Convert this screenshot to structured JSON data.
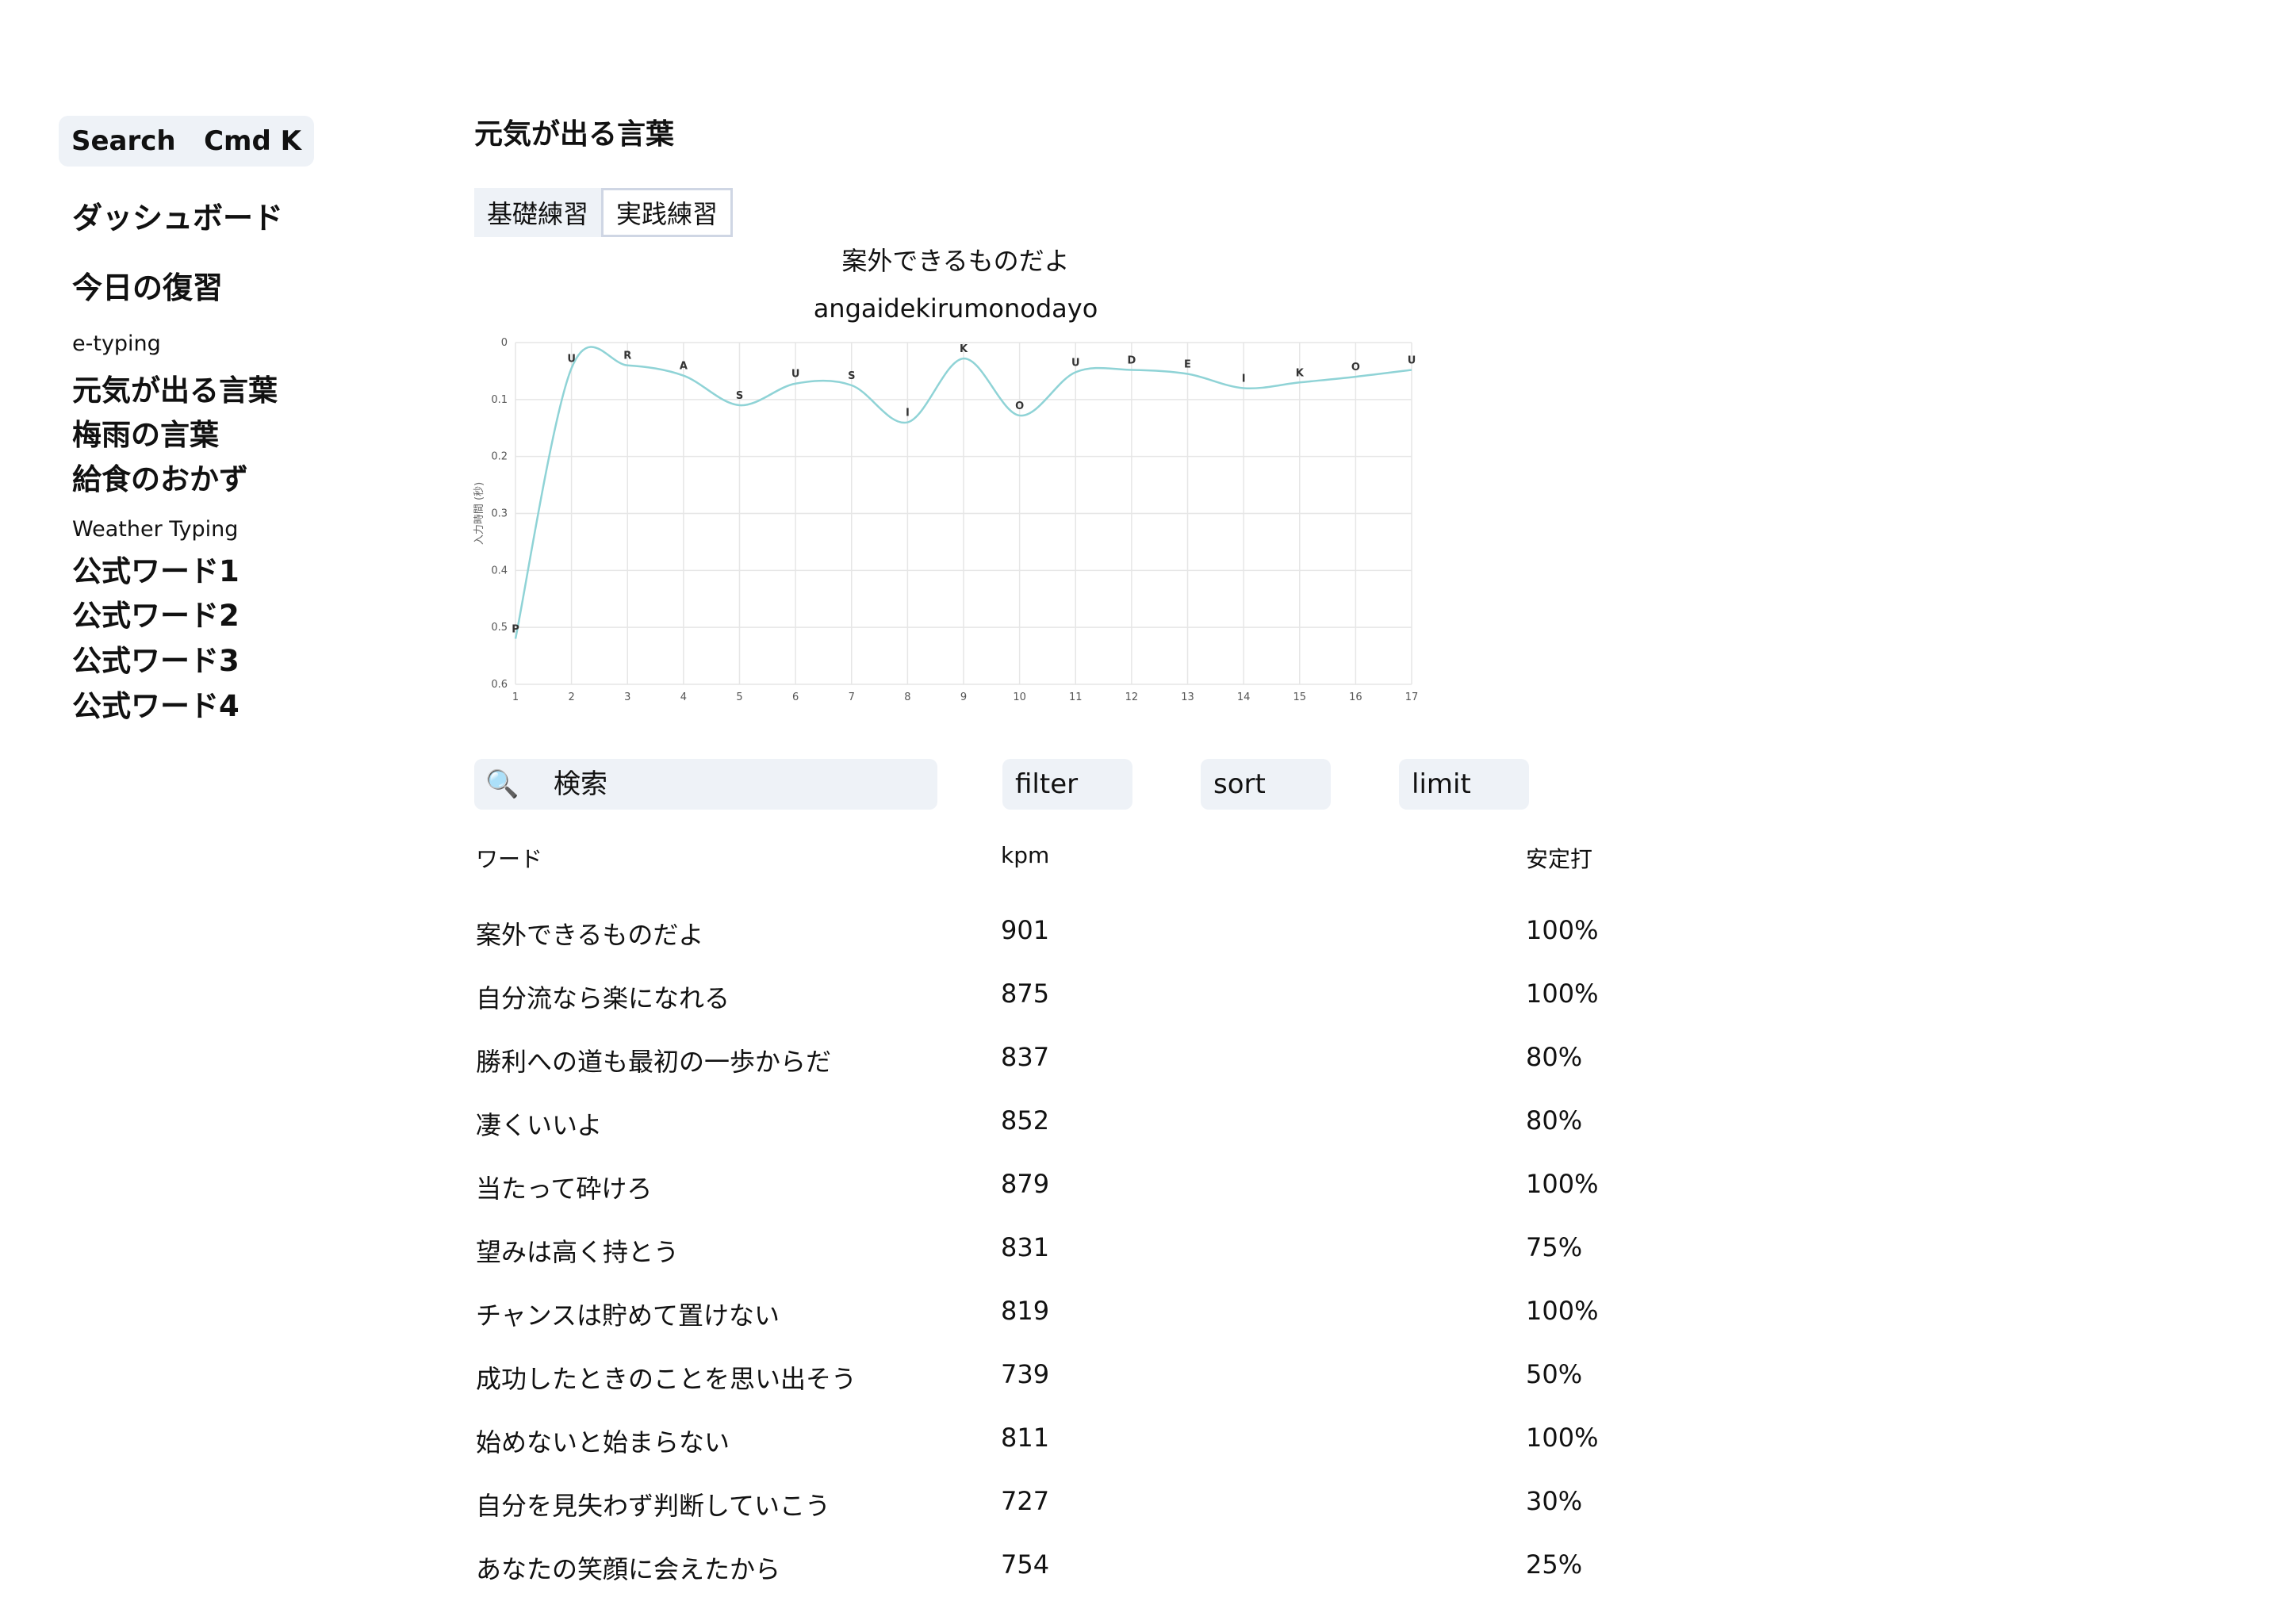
{
  "sidebar": {
    "search_label": "Search",
    "search_shortcut": "Cmd K",
    "dashboard": "ダッシュボード",
    "todays_review": "今日の復習",
    "groups": [
      {
        "label": "e-typing",
        "items": [
          "元気が出る言葉",
          "梅雨の言葉",
          "給食のおかず"
        ]
      },
      {
        "label": "Weather Typing",
        "items": [
          "公式ワード1",
          "公式ワード2",
          "公式ワード3",
          "公式ワード4"
        ]
      }
    ]
  },
  "main": {
    "title": "元気が出る言葉",
    "tabs": [
      "基礎練習",
      "実践練習"
    ],
    "active_tab": "実践練習",
    "phrase": "案外できるものだよ",
    "romaji": "angaidekirumonodayo"
  },
  "chart_data": {
    "type": "line",
    "xlabel": "",
    "ylabel": "入力時間 (秒)",
    "x": [
      1,
      2,
      3,
      4,
      5,
      6,
      7,
      8,
      9,
      10,
      11,
      12,
      13,
      14,
      15,
      16,
      17
    ],
    "point_labels": [
      "P",
      "U",
      "R",
      "A",
      "S",
      "U",
      "S",
      "I",
      "K",
      "O",
      "U",
      "D",
      "E",
      "I",
      "K",
      "O",
      "U"
    ],
    "series": [
      {
        "values": [
          0.52,
          0.045,
          0.04,
          0.058,
          0.11,
          0.072,
          0.075,
          0.14,
          0.028,
          0.128,
          0.052,
          0.048,
          0.055,
          0.08,
          0.07,
          0.06,
          0.048
        ]
      }
    ],
    "ylim": [
      0,
      0.6
    ],
    "y_inverted": true,
    "yticks": [
      0,
      0.1,
      0.2,
      0.3,
      0.4,
      0.5,
      0.6
    ],
    "grid": true,
    "line_color": "#8fd3d6"
  },
  "controls": {
    "search_placeholder": "検索",
    "filter": "filter",
    "sort": "sort",
    "limit": "limit"
  },
  "table": {
    "headers": [
      "ワード",
      "kpm",
      "安定打"
    ],
    "rows": [
      [
        "案外できるものだよ",
        "901",
        "100%"
      ],
      [
        "自分流なら楽になれる",
        "875",
        "100%"
      ],
      [
        "勝利への道も最初の一歩からだ",
        "837",
        "80%"
      ],
      [
        "凄くいいよ",
        "852",
        "80%"
      ],
      [
        "当たって砕けろ",
        "879",
        "100%"
      ],
      [
        "望みは高く持とう",
        "831",
        "75%"
      ],
      [
        "チャンスは貯めて置けない",
        "819",
        "100%"
      ],
      [
        "成功したときのことを思い出そう",
        "739",
        "50%"
      ],
      [
        "始めないと始まらない",
        "811",
        "100%"
      ],
      [
        "自分を見失わず判断していこう",
        "727",
        "30%"
      ],
      [
        "あなたの笑顔に会えたから",
        "754",
        "25%"
      ]
    ]
  }
}
